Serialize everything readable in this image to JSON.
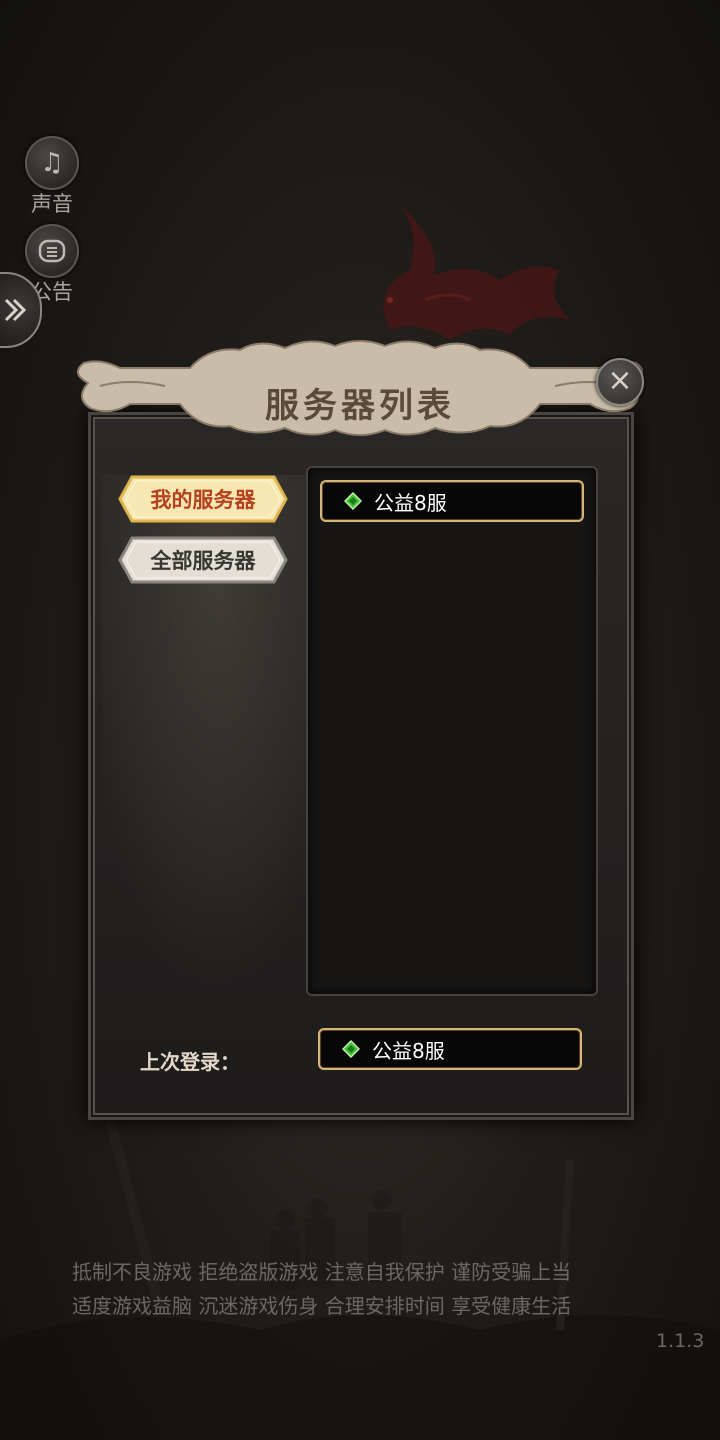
{
  "side_menu": {
    "sound_label": "声音",
    "notice_label": "公告"
  },
  "dialog": {
    "title": "服务器列表",
    "close_glyph": "×"
  },
  "tabs": {
    "mine": "我的服务器",
    "all": "全部服务器"
  },
  "servers": [
    {
      "name": "公益8服"
    }
  ],
  "last_login": {
    "label": "上次登录：",
    "server": "公益8服"
  },
  "footer": {
    "notice_line1": "抵制不良游戏 拒绝盗版游戏 注意自我保护 谨防受骗上当",
    "notice_line2": "适度游戏益脑 沉迷游戏伤身 合理安排时间 享受健康生活",
    "version": "1.1.3"
  },
  "icons": {
    "sound": "music-note-icon",
    "notice": "notice-list-icon",
    "collapse": "double-chevron-icon",
    "close": "close-icon",
    "server_status": "green-gem-icon"
  },
  "colors": {
    "tab_active_text": "#b5411f",
    "server_border": "#d6b676",
    "server_status_green": "#3fc43a"
  }
}
